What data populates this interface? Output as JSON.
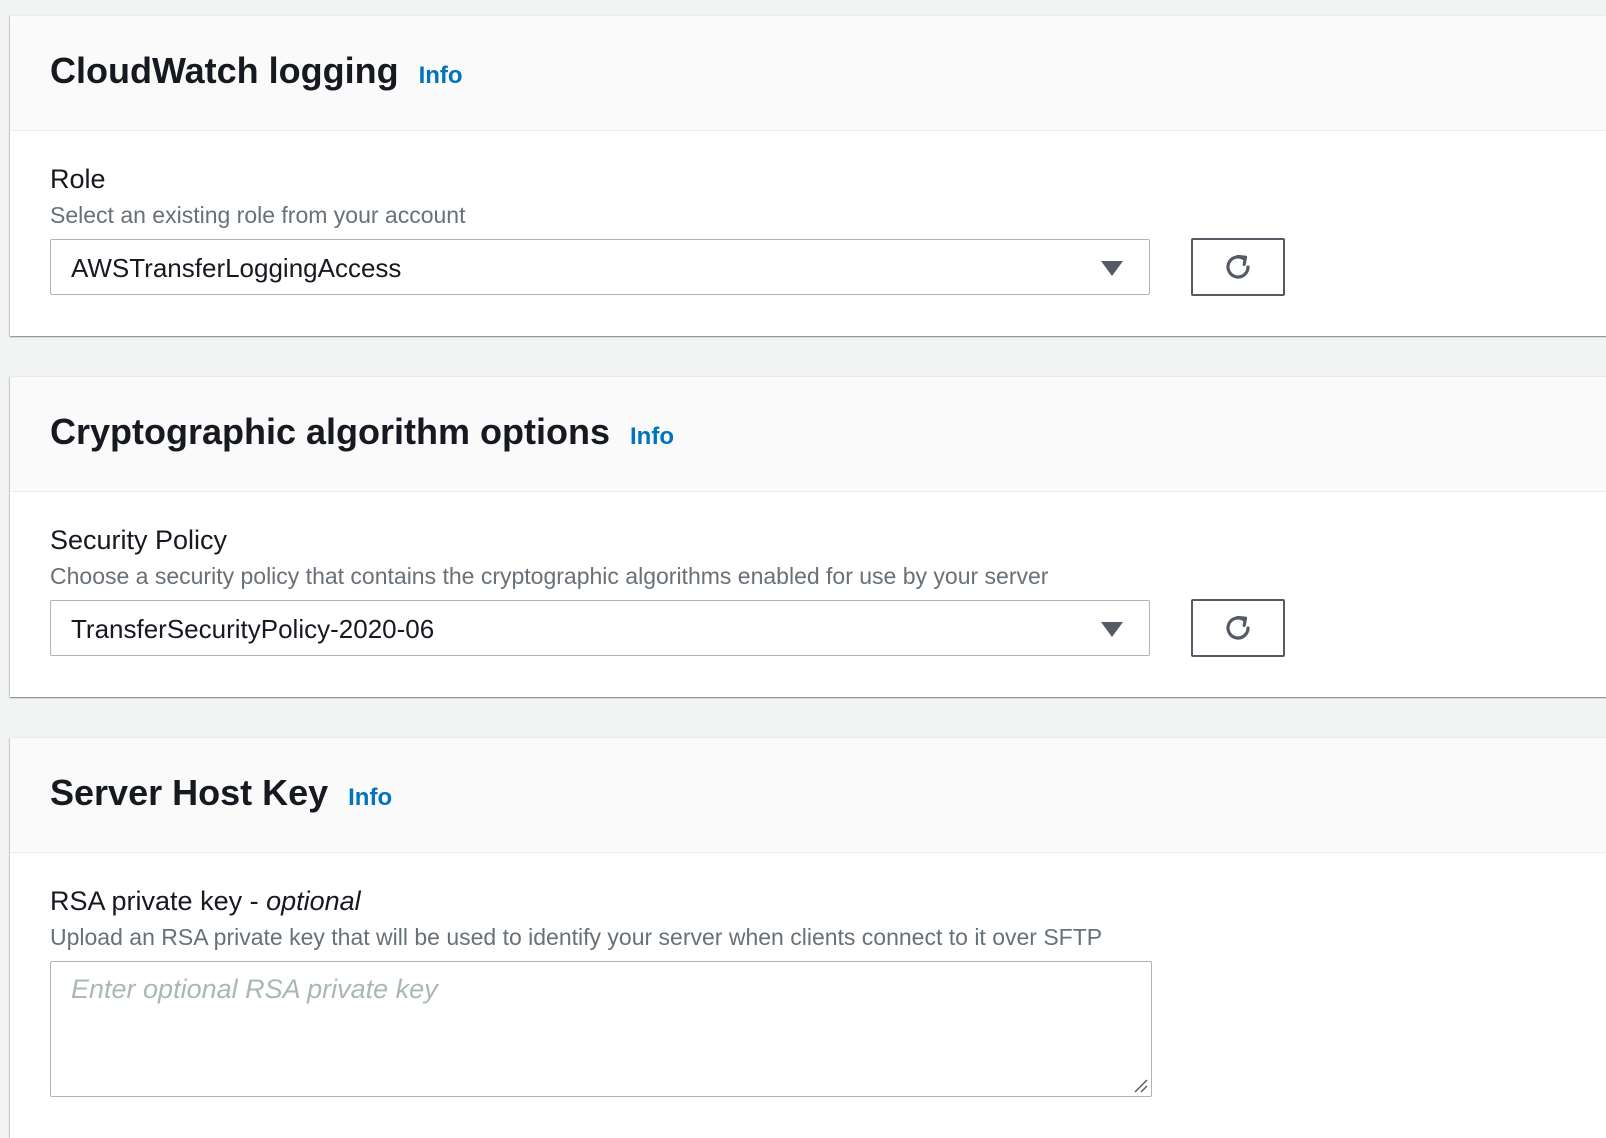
{
  "cloudwatch": {
    "title": "CloudWatch logging",
    "info": "Info",
    "role_label": "Role",
    "role_desc": "Select an existing role from your account",
    "role_value": "AWSTransferLoggingAccess"
  },
  "crypto": {
    "title": "Cryptographic algorithm options",
    "info": "Info",
    "policy_label": "Security Policy",
    "policy_desc": "Choose a security policy that contains the cryptographic algorithms enabled for use by your server",
    "policy_value": "TransferSecurityPolicy-2020-06"
  },
  "hostkey": {
    "title": "Server Host Key",
    "info": "Info",
    "rsa_label": "RSA private key - ",
    "rsa_optional": "optional",
    "rsa_desc": "Upload an RSA private key that will be used to identify your server when clients connect to it over SFTP",
    "rsa_placeholder": "Enter optional RSA private key"
  },
  "icons": {
    "refresh": "refresh-icon",
    "caret": "caret-down-icon",
    "resize": "resize-handle-icon"
  },
  "colors": {
    "link": "#0073bb",
    "text": "#16191f",
    "muted": "#687078",
    "border": "#aab7b8",
    "background": "#f2f3f3"
  }
}
